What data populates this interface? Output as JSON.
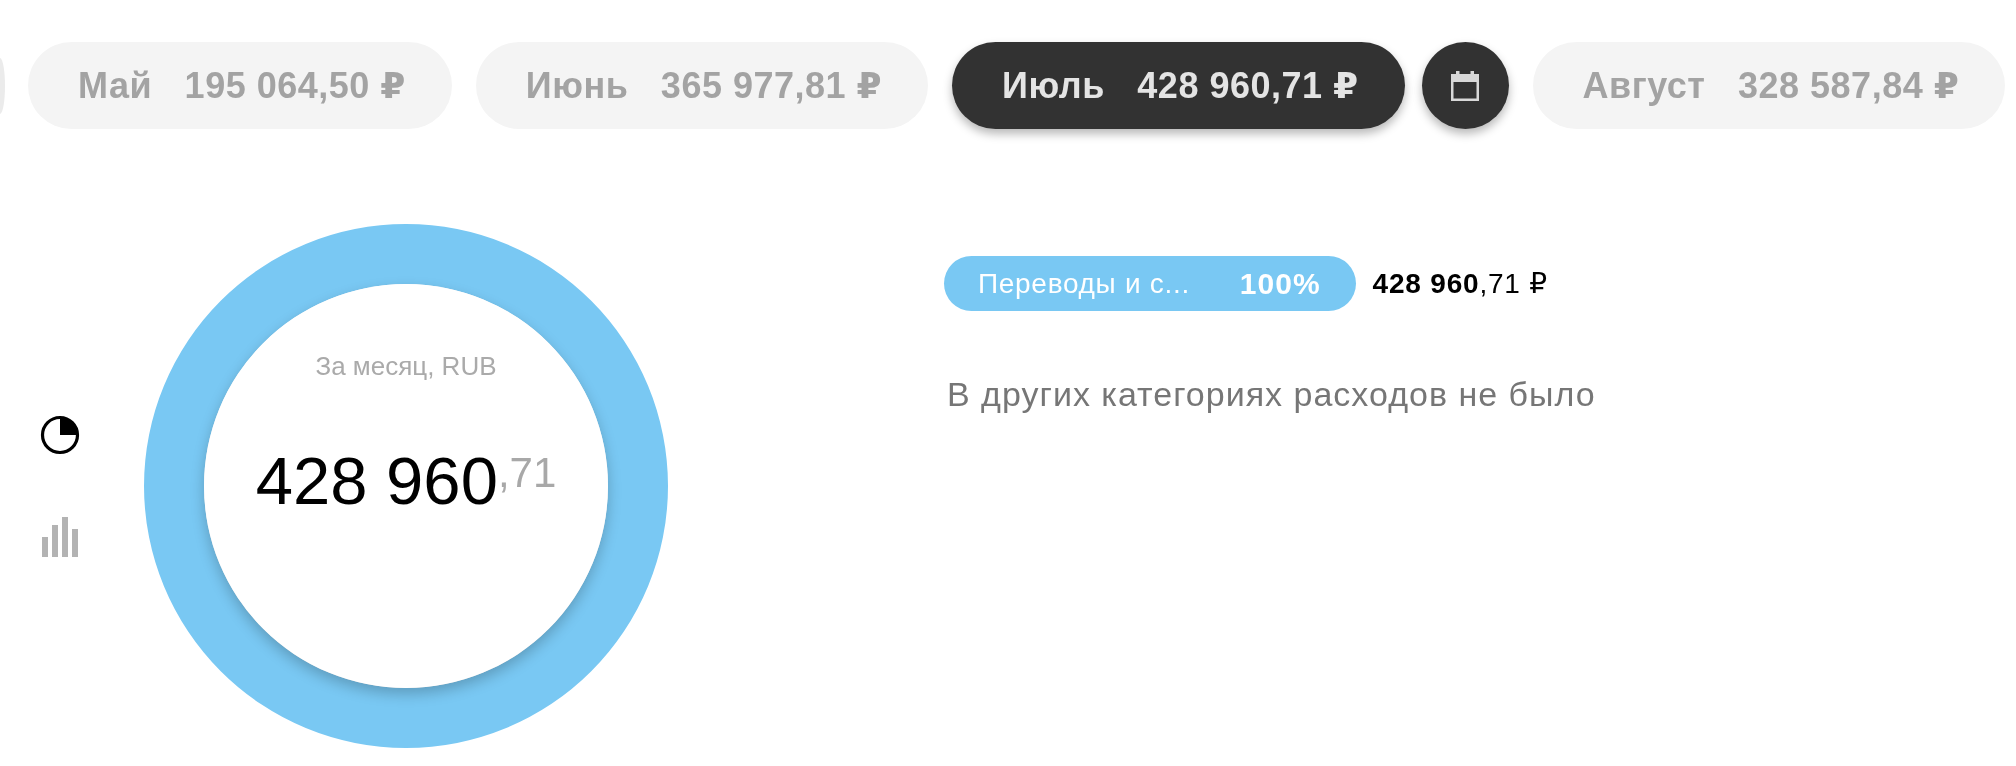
{
  "months": [
    {
      "label": "Май",
      "amount": "195 064,50 ₽",
      "selected": false
    },
    {
      "label": "Июнь",
      "amount": "365 977,81 ₽",
      "selected": false
    },
    {
      "label": "Июль",
      "amount": "428 960,71 ₽",
      "selected": true
    },
    {
      "label": "Август",
      "amount": "328 587,84 ₽",
      "selected": false
    }
  ],
  "views": [
    {
      "kind": "pie",
      "selected": true
    },
    {
      "kind": "bars",
      "selected": false
    }
  ],
  "chart": {
    "caption": "За месяц, RUB",
    "total": "428 960$^{,71}$",
    "chart_data": {
      "type": "donut",
      "categories": [
        "Переводы и с..."
      ],
      "values": [
        100
      ]
    }
  },
  "legend": [
    {
      "share": "100%",
      "amount": "**428 960**,71 ₽",
      "color": "#79c8f3"
    }
  ],
  "empty_note": "В других категориях расходов не было"
}
